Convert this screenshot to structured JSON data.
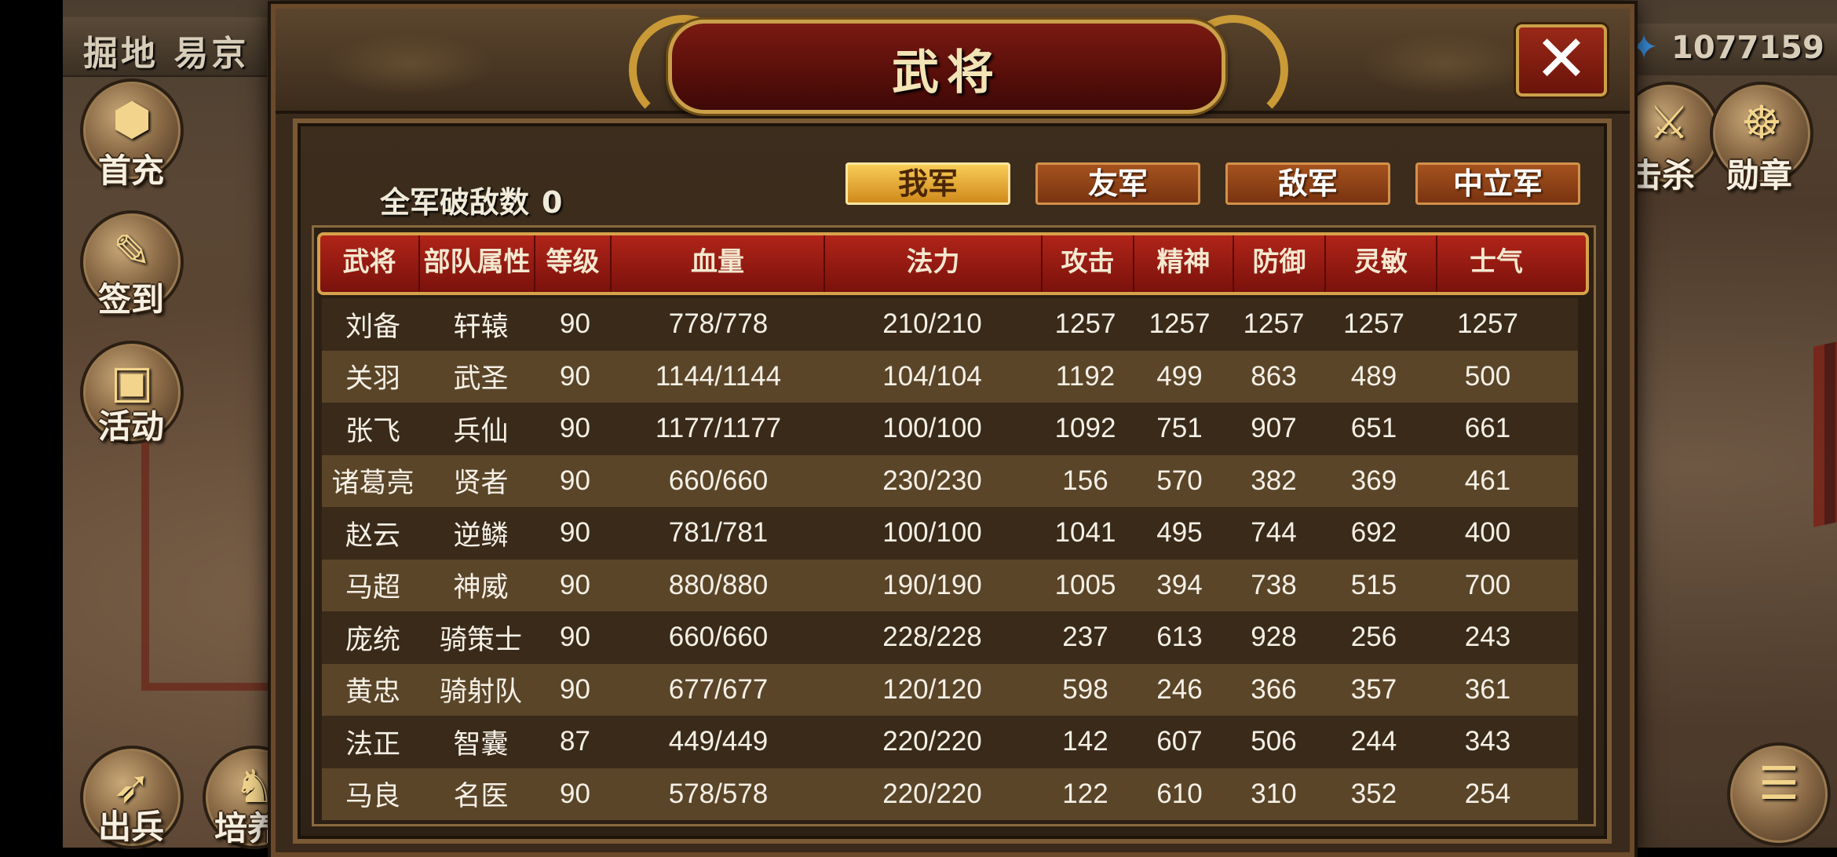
{
  "location": {
    "label": "掘地 易京"
  },
  "currency": {
    "icon": "blue-wing-icon",
    "value": "1077159"
  },
  "left_menu": [
    {
      "label": "首充",
      "icon": "gold-ingot-icon"
    },
    {
      "label": "签到",
      "icon": "scroll-brush-icon"
    },
    {
      "label": "活动",
      "icon": "treasure-chest-icon"
    },
    {
      "label": "出兵",
      "icon": "war-horn-icon"
    },
    {
      "label": "培养",
      "icon": "horse-statue-icon"
    }
  ],
  "right_menu": [
    {
      "label": "击杀",
      "icon": "crossed-swords-icon"
    },
    {
      "label": "勋章",
      "icon": "beast-mask-icon"
    },
    {
      "label": "",
      "icon": "menu-bars-icon"
    }
  ],
  "dialog": {
    "title": "武将",
    "close_icon": "close-icon",
    "kill_label": "全军破敌数",
    "kill_value": "0",
    "tabs": [
      "我军",
      "友军",
      "敌军",
      "中立军"
    ],
    "active_tab": "我军",
    "columns": [
      "武将",
      "部队属性",
      "等级",
      "血量",
      "法力",
      "攻击",
      "精神",
      "防御",
      "灵敏",
      "士气"
    ],
    "rows": [
      [
        "刘备",
        "轩辕",
        "90",
        "778/778",
        "210/210",
        "1257",
        "1257",
        "1257",
        "1257",
        "1257"
      ],
      [
        "关羽",
        "武圣",
        "90",
        "1144/1144",
        "104/104",
        "1192",
        "499",
        "863",
        "489",
        "500"
      ],
      [
        "张飞",
        "兵仙",
        "90",
        "1177/1177",
        "100/100",
        "1092",
        "751",
        "907",
        "651",
        "661"
      ],
      [
        "诸葛亮",
        "贤者",
        "90",
        "660/660",
        "230/230",
        "156",
        "570",
        "382",
        "369",
        "461"
      ],
      [
        "赵云",
        "逆鳞",
        "90",
        "781/781",
        "100/100",
        "1041",
        "495",
        "744",
        "692",
        "400"
      ],
      [
        "马超",
        "神威",
        "90",
        "880/880",
        "190/190",
        "1005",
        "394",
        "738",
        "515",
        "700"
      ],
      [
        "庞统",
        "骑策士",
        "90",
        "660/660",
        "228/228",
        "237",
        "613",
        "928",
        "256",
        "243"
      ],
      [
        "黄忠",
        "骑射队",
        "90",
        "677/677",
        "120/120",
        "598",
        "246",
        "366",
        "357",
        "361"
      ],
      [
        "法正",
        "智囊",
        "87",
        "449/449",
        "220/220",
        "142",
        "607",
        "506",
        "244",
        "343"
      ],
      [
        "马良",
        "名医",
        "90",
        "578/578",
        "220/220",
        "122",
        "610",
        "310",
        "352",
        "254"
      ]
    ]
  },
  "colors": {
    "header_red": "#9a1c12",
    "tab_gold": "#e6a83a",
    "tab_brown": "#8a4216",
    "gold_trim": "#caa04a"
  }
}
